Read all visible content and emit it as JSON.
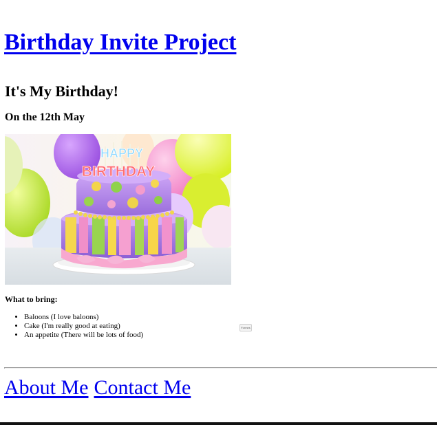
{
  "header": {
    "title": "Birthday Invite Project"
  },
  "invite": {
    "heading": "It's My Birthday!",
    "date": "On the 12th May",
    "image": {
      "alt": "Birthday cake with candles spelling HAPPY BIRTHDAY",
      "candles_text_top": "HAPPY",
      "candles_text_bottom": "BIRTHDAY"
    },
    "bring_heading": "What to bring:",
    "bring_items": [
      "Baloons (I love baloons)",
      "Cake (I'm really good at eating)",
      "An appetite (There will be lots of food)"
    ],
    "small_button_label": "Formes"
  },
  "footer": {
    "links": [
      "About Me",
      "Contact Me"
    ]
  },
  "colors": {
    "link": "#0000ee",
    "text": "#000000",
    "background": "#ffffff",
    "divider": "#999999"
  },
  "icons": {
    "list_marker": "bullet-icon"
  }
}
